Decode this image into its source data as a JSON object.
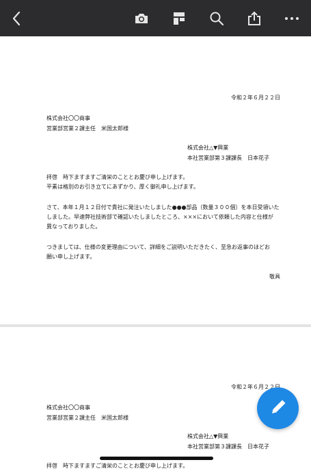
{
  "toolbar": {
    "icons": [
      "back-icon",
      "camera-icon",
      "bookmark-icon",
      "search-icon",
      "share-icon",
      "more-icon"
    ],
    "background": "#2c2c2e"
  },
  "letter": {
    "date": "令和２年６月２２日",
    "recipient_company": "株式会社〇〇商事",
    "recipient_person": "営業部営業２課主任　米国太郎様",
    "sender_company": "株式会社△▼興業",
    "sender_person": "本社営業部第３課課長　日本花子",
    "p1_line1": "拝啓　時下ますますご清栄のこととお慶び申し上げます。",
    "p1_line2": "平素は格別のお引き立てにあずかり、厚く御礼申し上げます。",
    "p2_line1": "さて、本年１月１２日付で貴社に発注いたしました●●●部品（数量３００個）を本日受領いた",
    "p2_line2": "しました。早速弊社技術部で確認いたしましたところ、×××において依頼した内容と仕様が",
    "p2_line3": "異なっておりました。",
    "p3_line1": "つきましては、仕様の変更理由について、詳細をご説明いただきたく、至急お返事のほどお",
    "p3_line2": "願い申し上げます。",
    "closing": "敬具"
  },
  "page2": {
    "date": "令和２年６月２２日",
    "recipient_company": "株式会社〇〇商事",
    "recipient_person": "営業部営業２課主任　米国太郎様",
    "sender_company": "株式会社△▼興業",
    "sender_person": "本社営業部第３課課長　日本花子",
    "p1_line1": "拝啓　時下ますますご清栄のこととお慶び申し上げます。"
  },
  "fab": {
    "icon": "pencil-icon",
    "color": "#1e88e5"
  }
}
